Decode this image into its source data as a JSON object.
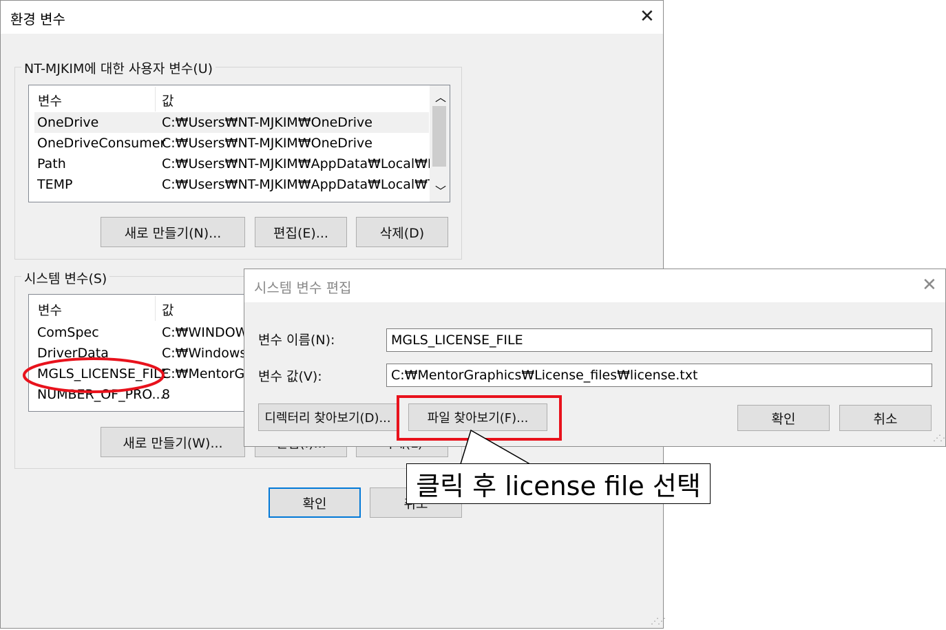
{
  "main_dialog": {
    "title": "환경 변수",
    "user_group": {
      "label": "NT-MJKIM에 대한 사용자 변수(U)",
      "col_name": "변수",
      "col_value": "값",
      "rows": [
        {
          "name": "OneDrive",
          "value": "C:₩Users₩NT-MJKIM₩OneDrive"
        },
        {
          "name": "OneDriveConsumer",
          "value": "C:₩Users₩NT-MJKIM₩OneDrive"
        },
        {
          "name": "Path",
          "value": "C:₩Users₩NT-MJKIM₩AppData₩Local₩Mi..."
        },
        {
          "name": "TEMP",
          "value": "C:₩Users₩NT-MJKIM₩AppData₩Local₩Te..."
        }
      ],
      "new_button": "새로 만들기(N)...",
      "edit_button": "편집(E)...",
      "delete_button": "삭제(D)"
    },
    "system_group": {
      "label": "시스템 변수(S)",
      "col_name": "변수",
      "col_value": "값",
      "rows": [
        {
          "name": "ComSpec",
          "value": "C:₩WINDOWS"
        },
        {
          "name": "DriverData",
          "value": "C:₩Windows₩"
        },
        {
          "name": "MGLS_LICENSE_FILE",
          "value": "C:₩MentorGra"
        },
        {
          "name": "NUMBER_OF_PRO...",
          "value": "8"
        }
      ],
      "new_button": "새로 만들기(W)...",
      "edit_button": "편집(I)...",
      "delete_button": "삭제(L)"
    },
    "ok_button": "확인",
    "cancel_button": "취소"
  },
  "edit_dialog": {
    "title": "시스템 변수 편집",
    "name_label": "변수 이름(N):",
    "name_value": "MGLS_LICENSE_FILE",
    "value_label": "변수 값(V):",
    "value_value": "C:₩MentorGraphics₩License_files₩license.txt",
    "browse_dir_button": "디렉터리 찾아보기(D)...",
    "browse_file_button": "파일 찾아보기(F)...",
    "ok_button": "확인",
    "cancel_button": "취소"
  },
  "annotation": {
    "callout_text": "클릭 후 license file 선택",
    "highlight_color": "#e8121c"
  },
  "icons": {
    "close": "close-icon",
    "scroll_up": "chevron-up-icon",
    "scroll_down": "chevron-down-icon"
  }
}
